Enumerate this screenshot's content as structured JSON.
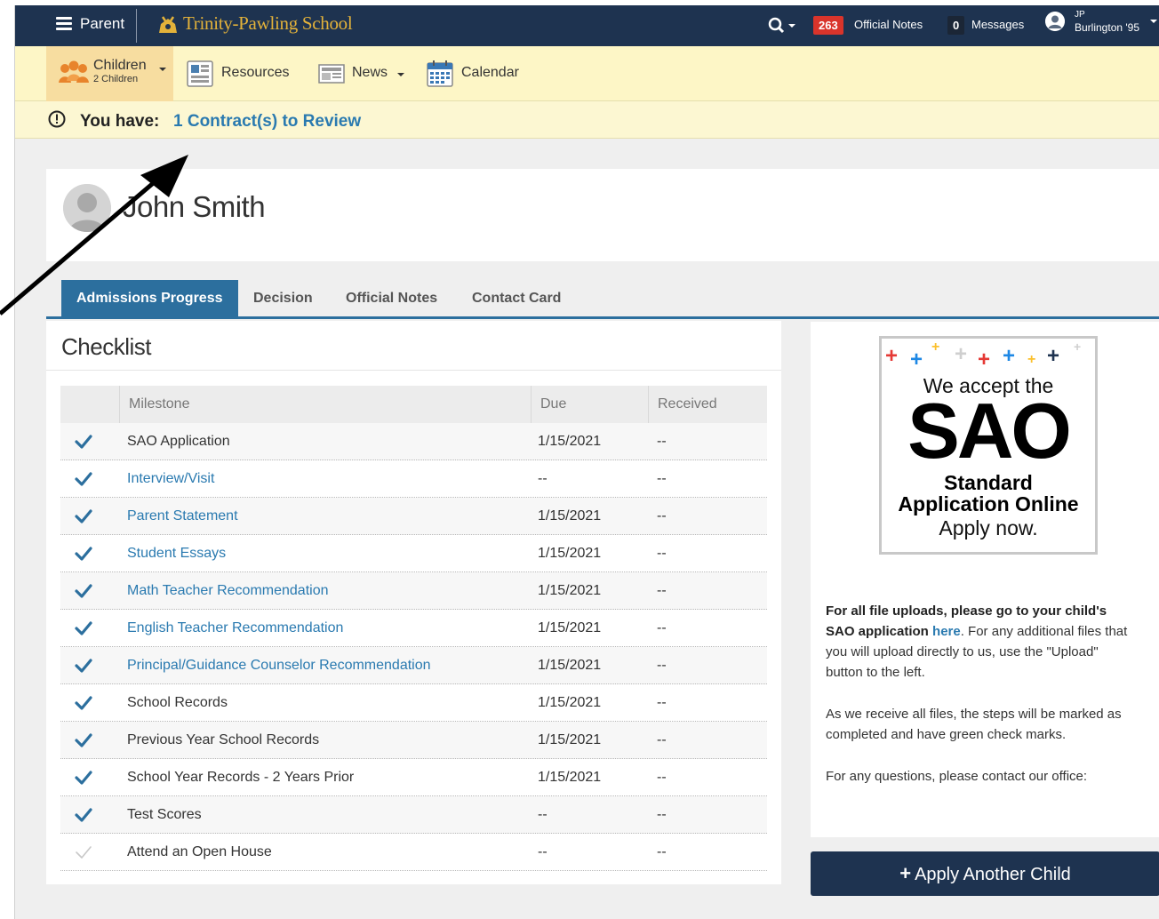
{
  "topbar": {
    "role_label": "Parent",
    "school_name": "Trinity-Pawling School",
    "official_notes_count": "263",
    "official_notes_label": "Official Notes",
    "messages_count": "0",
    "messages_label": "Messages",
    "user_initials": "JP",
    "user_class": "Burlington '95"
  },
  "subnav": {
    "children_label": "Children",
    "children_count": "2 Children",
    "resources_label": "Resources",
    "news_label": "News",
    "calendar_label": "Calendar"
  },
  "alert": {
    "prefix": "You have:",
    "link_text": "1 Contract(s) to Review"
  },
  "profile": {
    "name": "John Smith"
  },
  "tabs": [
    {
      "label": "Admissions Progress",
      "active": true
    },
    {
      "label": "Decision",
      "active": false
    },
    {
      "label": "Official Notes",
      "active": false
    },
    {
      "label": "Contact Card",
      "active": false
    }
  ],
  "checklist": {
    "title": "Checklist",
    "columns": [
      "Milestone",
      "Due",
      "Received"
    ],
    "rows": [
      {
        "milestone": "SAO Application",
        "due": "1/15/2021",
        "received": "--",
        "link": false,
        "complete": true
      },
      {
        "milestone": "Interview/Visit",
        "due": "--",
        "received": "--",
        "link": true,
        "complete": true
      },
      {
        "milestone": "Parent Statement",
        "due": "1/15/2021",
        "received": "--",
        "link": true,
        "complete": true
      },
      {
        "milestone": "Student Essays",
        "due": "1/15/2021",
        "received": "--",
        "link": true,
        "complete": true
      },
      {
        "milestone": "Math Teacher Recommendation",
        "due": "1/15/2021",
        "received": "--",
        "link": true,
        "complete": true
      },
      {
        "milestone": "English Teacher Recommendation",
        "due": "1/15/2021",
        "received": "--",
        "link": true,
        "complete": true
      },
      {
        "milestone": "Principal/Guidance Counselor Recommendation",
        "due": "1/15/2021",
        "received": "--",
        "link": true,
        "complete": true
      },
      {
        "milestone": "School Records",
        "due": "1/15/2021",
        "received": "--",
        "link": false,
        "complete": true
      },
      {
        "milestone": "Previous Year School Records",
        "due": "1/15/2021",
        "received": "--",
        "link": false,
        "complete": true
      },
      {
        "milestone": "School Year Records - 2 Years Prior",
        "due": "1/15/2021",
        "received": "--",
        "link": false,
        "complete": true
      },
      {
        "milestone": "Test Scores",
        "due": "--",
        "received": "--",
        "link": false,
        "complete": true
      },
      {
        "milestone": "Attend an Open House",
        "due": "--",
        "received": "--",
        "link": false,
        "complete": false
      }
    ]
  },
  "sao_banner": {
    "line1": "We accept the",
    "big": "SAO",
    "line3": "Standard",
    "line4": "Application Online",
    "line5": "Apply now."
  },
  "sidepanel": {
    "para1_bold": "For all file uploads, please go to your child's SAO application",
    "para1_link": "here",
    "para1_rest": ". For any additional files that you will upload directly to us, use the \"Upload\"  button to the left.",
    "para2": "As we receive all files, the steps will be marked as completed and have green check marks.",
    "para3": "For any questions, please contact our office:"
  },
  "apply_button": {
    "label": "Apply Another Child"
  },
  "colors": {
    "navy": "#1e3350",
    "accent_blue": "#2c6f9e",
    "link_blue": "#2a7ab0",
    "badge_red": "#d9342b",
    "subnav_yellow": "#fdf6c6",
    "school_gold": "#e3b23a"
  }
}
